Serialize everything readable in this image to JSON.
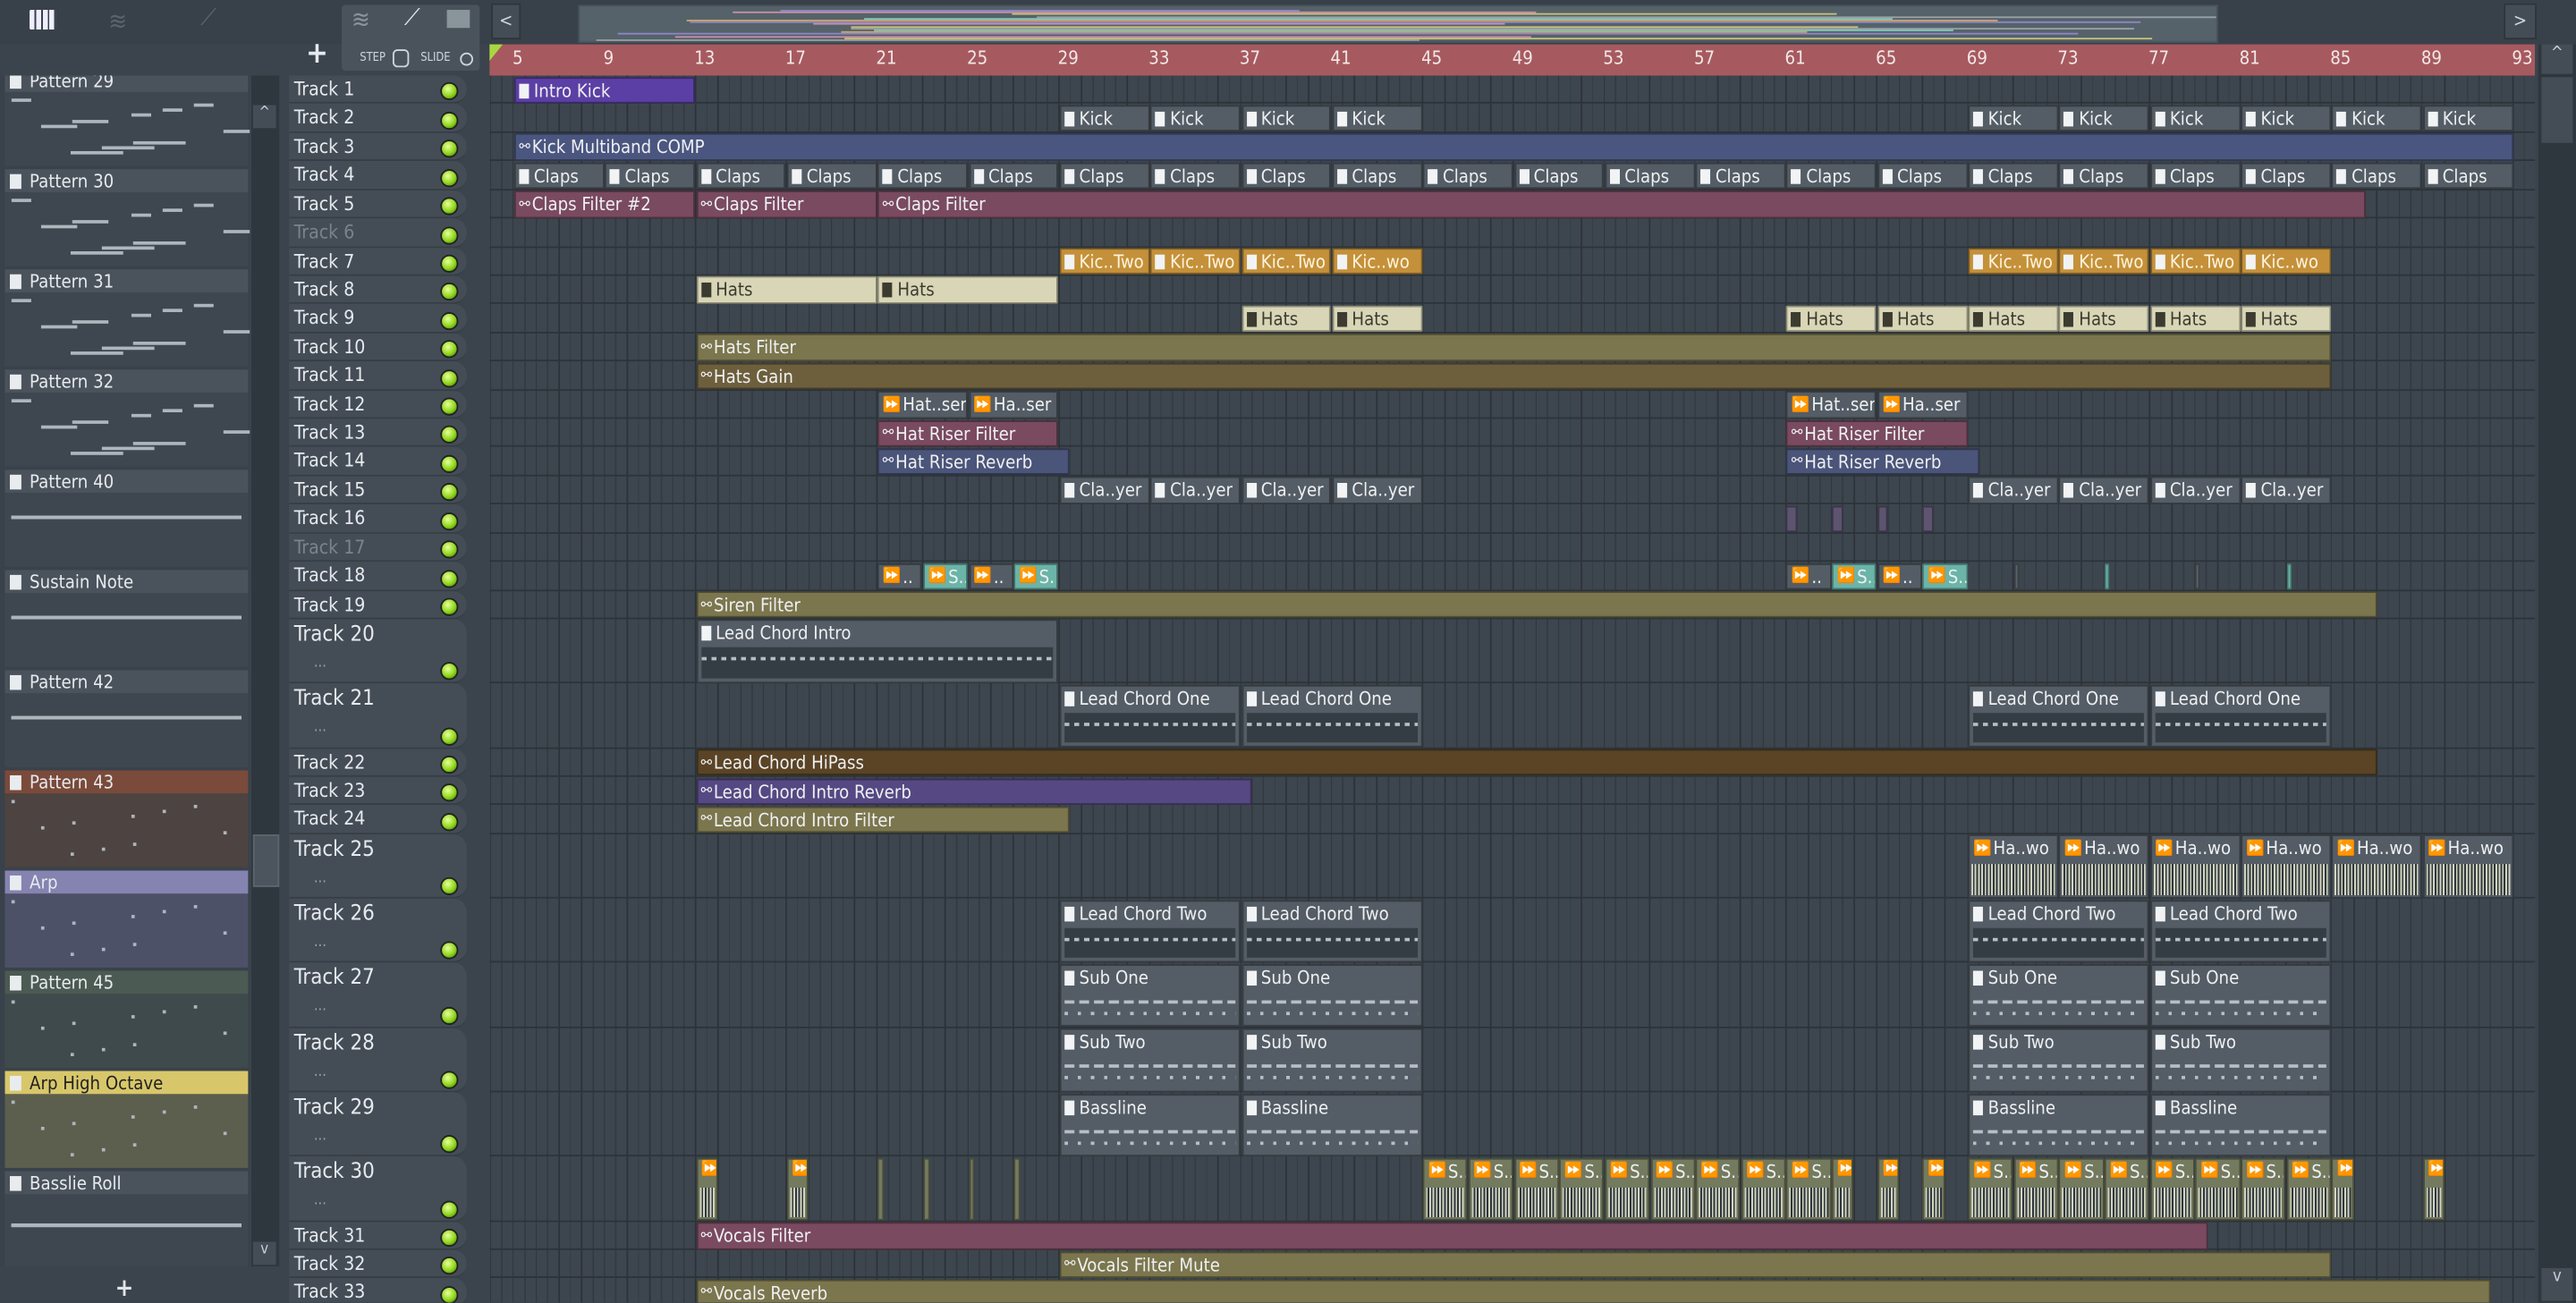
{
  "toolbar": {
    "icons": [
      "piano-roll-icon",
      "audio-wave-icon",
      "automation-icon"
    ],
    "add_label": "+",
    "step_label": "STEP",
    "slide_label": "SLIDE",
    "scroll_left": "<",
    "scroll_right": ">"
  },
  "patterns": [
    {
      "name": "Pattern 29",
      "color": "#4a535b",
      "bg": "#3e474f"
    },
    {
      "name": "Pattern 30",
      "color": "#4a535b",
      "bg": "#3e474f"
    },
    {
      "name": "Pattern 31",
      "color": "#4a535b",
      "bg": "#3e474f"
    },
    {
      "name": "Pattern 32",
      "color": "#4a535b",
      "bg": "#3e474f"
    },
    {
      "name": "Pattern 40",
      "color": "#4a535b",
      "bg": "#3e474f"
    },
    {
      "name": "Sustain Note",
      "color": "#4a535b",
      "bg": "#3e474f"
    },
    {
      "name": "Pattern 42",
      "color": "#4a535b",
      "bg": "#3e474f"
    },
    {
      "name": "Pattern 43",
      "color": "#7a4a3a",
      "bg": "#4d4340"
    },
    {
      "name": "Arp",
      "color": "#8583b0",
      "bg": "#4d5168"
    },
    {
      "name": "Pattern 45",
      "color": "#4b5a52",
      "bg": "#3e4a4b"
    },
    {
      "name": "Arp High Octave",
      "color": "#d8c76a",
      "bg": "#5c5f4d"
    },
    {
      "name": "Basslie Roll",
      "color": "#4a535b",
      "bg": "#3e474f"
    }
  ],
  "pattern_add_label": "+",
  "ruler": [
    "5",
    "9",
    "13",
    "17",
    "21",
    "25",
    "29",
    "33",
    "37",
    "41",
    "45",
    "49",
    "53",
    "57",
    "61",
    "65",
    "69",
    "73",
    "77",
    "81",
    "85",
    "89",
    "93"
  ],
  "tracks": [
    {
      "name": "Track 1",
      "clips": [
        [
          5,
          8,
          "Intro Kick",
          "purple",
          "p"
        ]
      ]
    },
    {
      "name": "Track 2",
      "clips": [
        [
          29,
          4,
          "Kick",
          "gray",
          "p"
        ],
        [
          33,
          4,
          "Kick",
          "gray",
          "p"
        ],
        [
          37,
          4,
          "Kick",
          "gray",
          "p"
        ],
        [
          41,
          4,
          "Kick",
          "gray",
          "p"
        ],
        [
          69,
          4,
          "Kick",
          "gray",
          "p"
        ],
        [
          73,
          4,
          "Kick",
          "gray",
          "p"
        ],
        [
          77,
          4,
          "Kick",
          "gray",
          "p"
        ],
        [
          81,
          4,
          "Kick",
          "gray",
          "p"
        ],
        [
          85,
          4,
          "Kick",
          "gray",
          "p"
        ],
        [
          89,
          4,
          "Kick",
          "gray",
          "p"
        ]
      ]
    },
    {
      "name": "Track 3",
      "clips": [
        [
          5,
          88,
          "Kick Multiband COMP",
          "blue",
          "a"
        ]
      ]
    },
    {
      "name": "Track 4",
      "clips": "claps"
    },
    {
      "name": "Track 5",
      "clips": [
        [
          5,
          8,
          "Claps Filter #2",
          "pink",
          "a"
        ],
        [
          13,
          8,
          "Claps Filter",
          "pink",
          "a"
        ],
        [
          21,
          65.5,
          "Claps Filter",
          "pink",
          "a"
        ]
      ]
    },
    {
      "name": "Track 6",
      "dim": true,
      "clips": []
    },
    {
      "name": "Track 7",
      "clips": [
        [
          29,
          4,
          "Kic..Two",
          "orange",
          "p"
        ],
        [
          33,
          4,
          "Kic..Two",
          "orange",
          "p"
        ],
        [
          37,
          4,
          "Kic..Two",
          "orange",
          "p"
        ],
        [
          41,
          4,
          "Kic..wo",
          "orange",
          "p"
        ],
        [
          69,
          4,
          "Kic..Two",
          "orange",
          "p"
        ],
        [
          73,
          4,
          "Kic..Two",
          "orange",
          "p"
        ],
        [
          77,
          4,
          "Kic..Two",
          "orange",
          "p"
        ],
        [
          81,
          4,
          "Kic..wo",
          "orange",
          "p"
        ]
      ]
    },
    {
      "name": "Track 8",
      "clips": [
        [
          13,
          8,
          "Hats",
          "cream",
          "p"
        ],
        [
          21,
          8,
          "Hats",
          "cream",
          "p"
        ]
      ]
    },
    {
      "name": "Track 9",
      "clips": [
        [
          37,
          4,
          "Hats",
          "cream",
          "p"
        ],
        [
          41,
          4,
          "Hats",
          "cream",
          "p"
        ],
        [
          61,
          4,
          "Hats",
          "cream",
          "p"
        ],
        [
          65,
          4,
          "Hats",
          "cream",
          "p"
        ],
        [
          69,
          4,
          "Hats",
          "cream",
          "p"
        ],
        [
          73,
          4,
          "Hats",
          "cream",
          "p"
        ],
        [
          77,
          4,
          "Hats",
          "cream",
          "p"
        ],
        [
          81,
          4,
          "Hats",
          "cream",
          "p"
        ]
      ]
    },
    {
      "name": "Track 10",
      "clips": [
        [
          13,
          72,
          "Hats Filter",
          "olive",
          "a"
        ]
      ]
    },
    {
      "name": "Track 11",
      "clips": [
        [
          13,
          72,
          "Hats Gain",
          "brownolive",
          "a"
        ]
      ]
    },
    {
      "name": "Track 12",
      "clips": [
        [
          21,
          4,
          "Hat..ser",
          "gray",
          "s"
        ],
        [
          25,
          4,
          "Ha..ser",
          "gray",
          "s"
        ],
        [
          61,
          4,
          "Hat..ser",
          "gray",
          "s"
        ],
        [
          65,
          4,
          "Ha..ser",
          "gray",
          "s"
        ]
      ]
    },
    {
      "name": "Track 13",
      "clips": [
        [
          21,
          8,
          "Hat Riser Filter",
          "pink",
          "a"
        ],
        [
          61,
          8,
          "Hat Riser Filter",
          "pink",
          "a"
        ]
      ]
    },
    {
      "name": "Track 14",
      "clips": [
        [
          21,
          8.5,
          "Hat Riser Reverb",
          "steel",
          "a"
        ],
        [
          61,
          8.5,
          "Hat Riser Reverb",
          "steel",
          "a"
        ]
      ]
    },
    {
      "name": "Track 15",
      "clips": [
        [
          29,
          4,
          "Cla..yer",
          "gray",
          "p"
        ],
        [
          33,
          4,
          "Cla..yer",
          "gray",
          "p"
        ],
        [
          37,
          4,
          "Cla..yer",
          "gray",
          "p"
        ],
        [
          41,
          4,
          "Cla..yer",
          "gray",
          "p"
        ],
        [
          69,
          4,
          "Cla..yer",
          "gray",
          "p"
        ],
        [
          73,
          4,
          "Cla..yer",
          "gray",
          "p"
        ],
        [
          77,
          4,
          "Cla..yer",
          "gray",
          "p"
        ],
        [
          81,
          4,
          "Cla..yer",
          "gray",
          "p"
        ]
      ]
    },
    {
      "name": "Track 16",
      "clips": [
        [
          61,
          0.5,
          "",
          "lav",
          "n"
        ],
        [
          63,
          0.5,
          "",
          "lav",
          "n"
        ],
        [
          65,
          0.5,
          "",
          "lav",
          "n"
        ],
        [
          67,
          0.5,
          "",
          "lav",
          "n"
        ]
      ]
    },
    {
      "name": "Track 17",
      "dim": true,
      "clips": []
    },
    {
      "name": "Track 18",
      "clips": [
        [
          21,
          2,
          "..",
          "gray",
          "s"
        ],
        [
          23,
          2,
          "S..",
          "teal",
          "s"
        ],
        [
          25,
          2,
          "..",
          "gray",
          "s"
        ],
        [
          27,
          2,
          "S..",
          "teal",
          "s"
        ],
        [
          61,
          2,
          "..",
          "gray",
          "s"
        ],
        [
          63,
          2,
          "S..",
          "teal",
          "s"
        ],
        [
          65,
          2,
          "..",
          "gray",
          "s"
        ],
        [
          67,
          2,
          "S..",
          "teal",
          "s"
        ],
        [
          71,
          0.2,
          "",
          "tick",
          "n"
        ],
        [
          75,
          0.2,
          "",
          "teal",
          "n"
        ],
        [
          79,
          0.2,
          "",
          "tick",
          "n"
        ],
        [
          83,
          0.2,
          "",
          "teal",
          "n"
        ]
      ]
    },
    {
      "name": "Track 19",
      "clips": [
        [
          13,
          74,
          "Siren Filter",
          "olive",
          "a"
        ]
      ]
    },
    {
      "name": "Track 20",
      "tall": true,
      "clips": [
        [
          13,
          16,
          "Lead Chord Intro",
          "gray",
          "pt"
        ]
      ]
    },
    {
      "name": "Track 21",
      "tall": true,
      "clips": [
        [
          29,
          8,
          "Lead Chord One",
          "gray",
          "pt"
        ],
        [
          37,
          8,
          "Lead Chord One",
          "gray",
          "pt"
        ],
        [
          69,
          8,
          "Lead Chord One",
          "gray",
          "pt"
        ],
        [
          77,
          8,
          "Lead Chord One",
          "gray",
          "pt"
        ]
      ]
    },
    {
      "name": "Track 22",
      "clips": [
        [
          13,
          74,
          "Lead Chord HiPass",
          "brown",
          "a"
        ]
      ]
    },
    {
      "name": "Track 23",
      "clips": [
        [
          13,
          24.5,
          "Lead Chord Intro Reverb",
          "violet",
          "a"
        ]
      ]
    },
    {
      "name": "Track 24",
      "clips": [
        [
          13,
          16.5,
          "Lead Chord Intro Filter",
          "olive",
          "a"
        ]
      ]
    },
    {
      "name": "Track 25",
      "tall": true,
      "clips": [
        [
          69,
          4,
          "Ha..wo",
          "gray",
          "w"
        ],
        [
          73,
          4,
          "Ha..wo",
          "gray",
          "w"
        ],
        [
          77,
          4,
          "Ha..wo",
          "gray",
          "w"
        ],
        [
          81,
          4,
          "Ha..wo",
          "gray",
          "w"
        ],
        [
          85,
          4,
          "Ha..wo",
          "gray",
          "w"
        ],
        [
          89,
          4,
          "Ha..wo",
          "gray",
          "w"
        ]
      ]
    },
    {
      "name": "Track 26",
      "tall": true,
      "clips": [
        [
          29,
          8,
          "Lead Chord Two",
          "gray",
          "pt"
        ],
        [
          37,
          8,
          "Lead Chord Two",
          "gray",
          "pt"
        ],
        [
          69,
          8,
          "Lead Chord Two",
          "gray",
          "pt"
        ],
        [
          77,
          8,
          "Lead Chord Two",
          "gray",
          "pt"
        ]
      ]
    },
    {
      "name": "Track 27",
      "tall": true,
      "clips": [
        [
          29,
          8,
          "Sub One",
          "gray",
          "pt2"
        ],
        [
          37,
          8,
          "Sub One",
          "gray",
          "pt2"
        ],
        [
          69,
          8,
          "Sub One",
          "gray",
          "pt2"
        ],
        [
          77,
          8,
          "Sub One",
          "gray",
          "pt2"
        ]
      ]
    },
    {
      "name": "Track 28",
      "tall": true,
      "clips": [
        [
          29,
          8,
          "Sub Two",
          "gray",
          "pt2"
        ],
        [
          37,
          8,
          "Sub Two",
          "gray",
          "pt2"
        ],
        [
          69,
          8,
          "Sub Two",
          "gray",
          "pt2"
        ],
        [
          77,
          8,
          "Sub Two",
          "gray",
          "pt2"
        ]
      ]
    },
    {
      "name": "Track 29",
      "tall": true,
      "clips": [
        [
          29,
          8,
          "Bassline",
          "gray",
          "pt2"
        ],
        [
          37,
          8,
          "Bassline",
          "gray",
          "pt2"
        ],
        [
          69,
          8,
          "Bassline",
          "gray",
          "pt2"
        ],
        [
          77,
          8,
          "Bassline",
          "gray",
          "pt2"
        ]
      ]
    },
    {
      "name": "Track 30",
      "tall": true,
      "clips": "vox"
    },
    {
      "name": "Track 31",
      "clips": [
        [
          13,
          66.6,
          "Vocals Filter",
          "pink",
          "a"
        ]
      ]
    },
    {
      "name": "Track 32",
      "clips": [
        [
          29,
          56,
          "Vocals Filter Mute",
          "olive",
          "a"
        ]
      ]
    },
    {
      "name": "Track 33",
      "clips": [
        [
          13,
          79,
          "Vocals Reverb",
          "olive",
          "a"
        ]
      ]
    }
  ],
  "claps_label": "Claps",
  "vocal_chop_label": "S..",
  "track_more": "...",
  "colors": {
    "ruler": "#a65a5f",
    "led": "#8fd61c",
    "grid": "#3d464e"
  }
}
